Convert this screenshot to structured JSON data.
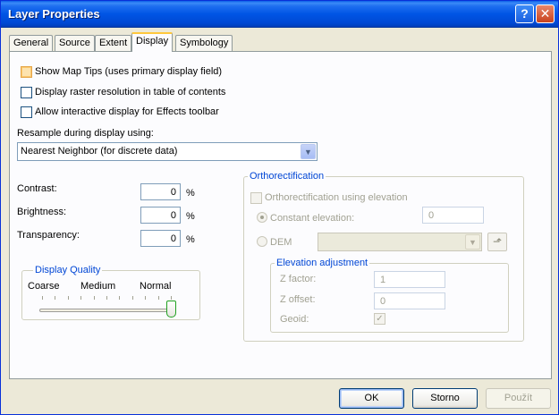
{
  "window": {
    "title": "Layer Properties",
    "help_glyph": "?",
    "close_glyph": "✕"
  },
  "tabs": [
    {
      "label": "General"
    },
    {
      "label": "Source"
    },
    {
      "label": "Extent"
    },
    {
      "label": "Display",
      "active": true
    },
    {
      "label": "Symbology"
    }
  ],
  "options": {
    "map_tips": "Show Map Tips (uses primary display field)",
    "raster_resolution": "Display raster resolution in table of contents",
    "effects_toolbar": "Allow interactive display for Effects toolbar"
  },
  "resample": {
    "label": "Resample during display using:",
    "value": "Nearest Neighbor (for discrete data)"
  },
  "contrast": {
    "label": "Contrast:",
    "value": "0",
    "unit": "%"
  },
  "brightness": {
    "label": "Brightness:",
    "value": "0",
    "unit": "%"
  },
  "transparency": {
    "label": "Transparency:",
    "value": "0",
    "unit": "%"
  },
  "display_quality": {
    "title": "Display Quality",
    "coarse": "Coarse",
    "medium": "Medium",
    "normal": "Normal",
    "level": 1.0
  },
  "ortho": {
    "title": "Orthorectification",
    "using_elevation": "Orthorectification using elevation",
    "constant_elevation": "Constant elevation:",
    "constant_value": "0",
    "dem": "DEM",
    "dem_value": "",
    "elev_adjust": {
      "title": "Elevation adjustment",
      "z_factor": "Z factor:",
      "z_factor_value": "1",
      "z_offset": "Z offset:",
      "z_offset_value": "0",
      "geoid": "Geoid:"
    }
  },
  "buttons": {
    "ok": "OK",
    "cancel": "Storno",
    "apply": "Použít"
  },
  "colors": {
    "title_bar": "#0055e5",
    "group_title": "#0046d5",
    "active_tab_accent": "#ffc83c"
  }
}
